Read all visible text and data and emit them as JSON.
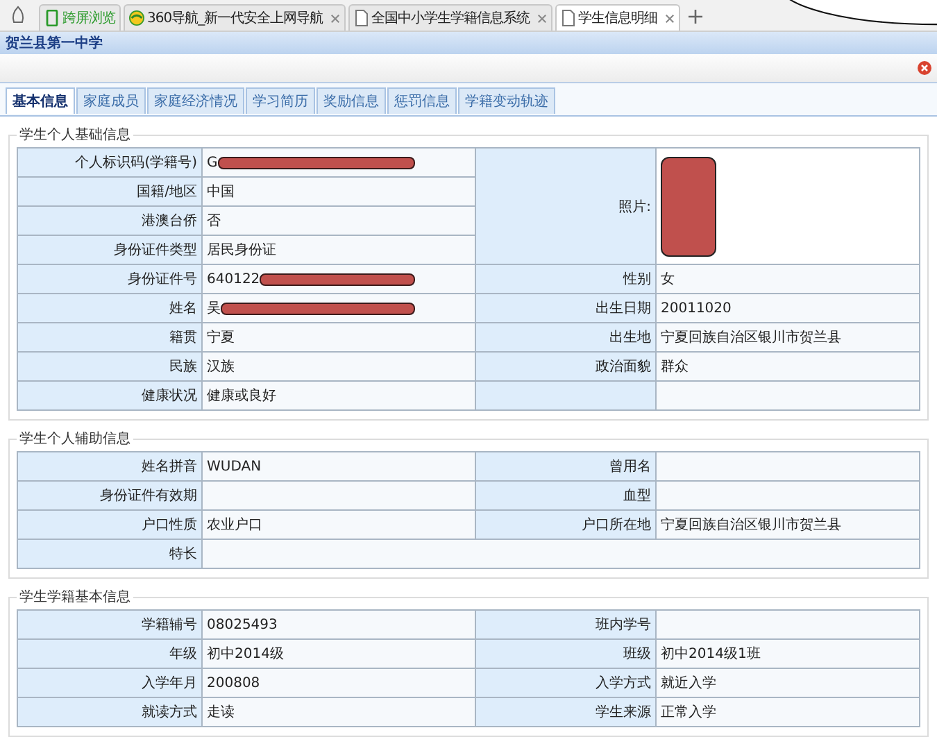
{
  "browser_tabs": [
    {
      "label": "跨屏浏览",
      "kind": "phone",
      "selected": false
    },
    {
      "label": "360导航_新一代安全上网导航",
      "kind": "globe",
      "selected": false
    },
    {
      "label": "全国中小学生学籍信息系统",
      "kind": "page",
      "selected": false
    },
    {
      "label": "学生信息明细",
      "kind": "page",
      "selected": true
    }
  ],
  "header": {
    "title": "贺兰县第一中学"
  },
  "tabs": [
    {
      "label": "基本信息",
      "selected": true
    },
    {
      "label": "家庭成员",
      "selected": false
    },
    {
      "label": "家庭经济情况",
      "selected": false
    },
    {
      "label": "学习简历",
      "selected": false
    },
    {
      "label": "奖励信息",
      "selected": false
    },
    {
      "label": "惩罚信息",
      "selected": false
    },
    {
      "label": "学籍变动轨迹",
      "selected": false
    }
  ],
  "basic": {
    "title": "学生个人基础信息",
    "left": [
      {
        "label": "个人标识码(学籍号)",
        "value": "G",
        "redacted": true
      },
      {
        "label": "国籍/地区",
        "value": "中国"
      },
      {
        "label": "港澳台侨",
        "value": "否"
      },
      {
        "label": "身份证件类型",
        "value": "居民身份证"
      },
      {
        "label": "身份证件号",
        "value": "640122",
        "redacted": true
      },
      {
        "label": "姓名",
        "value": "吴",
        "redacted": true
      },
      {
        "label": "籍贯",
        "value": "宁夏"
      },
      {
        "label": "民族",
        "value": "汉族"
      },
      {
        "label": "健康状况",
        "value": "健康或良好"
      }
    ],
    "photo": {
      "label": "照片:"
    },
    "right": [
      {
        "label": "性别",
        "value": "女"
      },
      {
        "label": "出生日期",
        "value": "20011020"
      },
      {
        "label": "出生地",
        "value": "宁夏回族自治区银川市贺兰县"
      },
      {
        "label": "政治面貌",
        "value": "群众"
      }
    ]
  },
  "sections": [
    {
      "title": "学生个人辅助信息",
      "rows": [
        [
          {
            "label": "姓名拼音",
            "value": "WUDAN"
          },
          {
            "label": "曾用名"
          }
        ],
        [
          {
            "label": "身份证件有效期"
          },
          {
            "label": "血型"
          }
        ],
        [
          {
            "label": "户口性质",
            "value": "农业户口"
          },
          {
            "label": "户口所在地",
            "value": "宁夏回族自治区银川市贺兰县"
          }
        ],
        [
          {
            "label": "特长"
          }
        ]
      ]
    },
    {
      "title": "学生学籍基本信息",
      "rows": [
        [
          {
            "label": "学籍辅号",
            "value": "08025493"
          },
          {
            "label": "班内学号"
          }
        ],
        [
          {
            "label": "年级",
            "value": "初中2014级"
          },
          {
            "label": "班级",
            "value": "初中2014级1班"
          }
        ],
        [
          {
            "label": "入学年月",
            "value": "200808"
          },
          {
            "label": "入学方式",
            "value": "就近入学"
          }
        ],
        [
          {
            "label": "就读方式",
            "value": "走读"
          },
          {
            "label": "学生来源",
            "value": "正常入学"
          }
        ]
      ]
    }
  ]
}
